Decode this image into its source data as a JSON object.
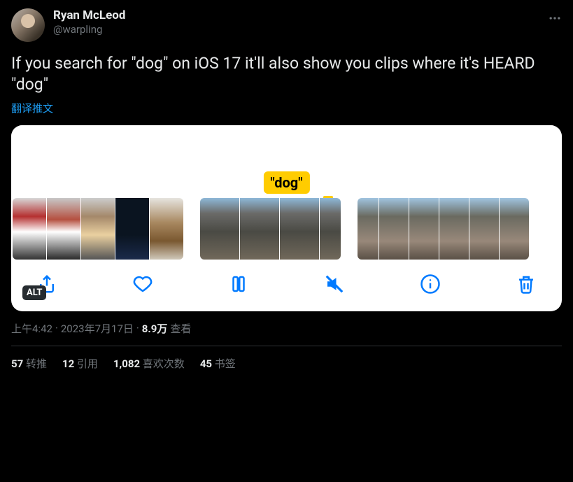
{
  "author": {
    "display_name": "Ryan McLeod",
    "handle": "@warpling"
  },
  "tweet_text": "If you search for \"dog\" on iOS 17 it'll also show you clips where it's HEARD \"dog\"",
  "translate_label": "翻译推文",
  "media": {
    "search_tag": "\"dog\"",
    "alt_badge": "ALT"
  },
  "meta": {
    "time": "上午4:42",
    "separator": " · ",
    "date": "2023年7月17日",
    "views_number": "8.9万",
    "views_label": "查看"
  },
  "stats": {
    "retweets_count": "57",
    "retweets_label": "转推",
    "quotes_count": "12",
    "quotes_label": "引用",
    "likes_count": "1,082",
    "likes_label": "喜欢次数",
    "bookmarks_count": "45",
    "bookmarks_label": "书签"
  },
  "icons": {
    "share": "share-icon",
    "like": "heart-icon",
    "pause": "pause-icon",
    "mute": "speaker-muted-icon",
    "info": "info-icon",
    "trash": "trash-icon"
  }
}
